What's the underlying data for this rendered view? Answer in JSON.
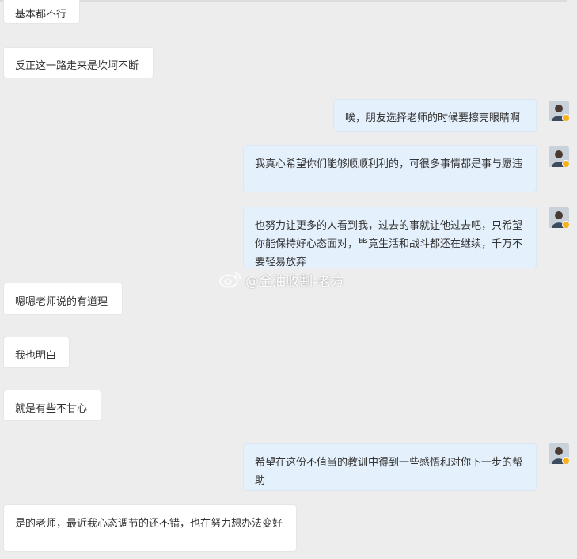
{
  "messages": [
    {
      "side": "left",
      "text": "基本都不行"
    },
    {
      "side": "left",
      "text": "反正这一路走来是坎坷不断"
    },
    {
      "side": "right",
      "text": "唉，朋友选择老师的时候要擦亮眼睛啊"
    },
    {
      "side": "right",
      "text": "我真心希望你们能够顺顺利利的，可很多事情都是事与愿违"
    },
    {
      "side": "right",
      "text": "也努力让更多的人看到我，过去的事就让他过去吧，只希望你能保持好心态面对，毕竟生活和战斗都还在继续，千万不要轻易放弃"
    },
    {
      "side": "left",
      "text": "嗯嗯老师说的有道理"
    },
    {
      "side": "left",
      "text": "我也明白"
    },
    {
      "side": "left",
      "text": "就是有些不甘心"
    },
    {
      "side": "right",
      "text": "希望在这份不值当的教训中得到一些感悟和对你下一步的帮助"
    },
    {
      "side": "left",
      "text": "是的老师，最近我心态调节的还不错，也在努力想办法变好"
    }
  ],
  "watermark": {
    "text": "@金油收割-老方",
    "icon": "weibo-icon"
  },
  "avatar": {
    "icon": "user-avatar-icon",
    "badge_color": "#f5b21a"
  }
}
